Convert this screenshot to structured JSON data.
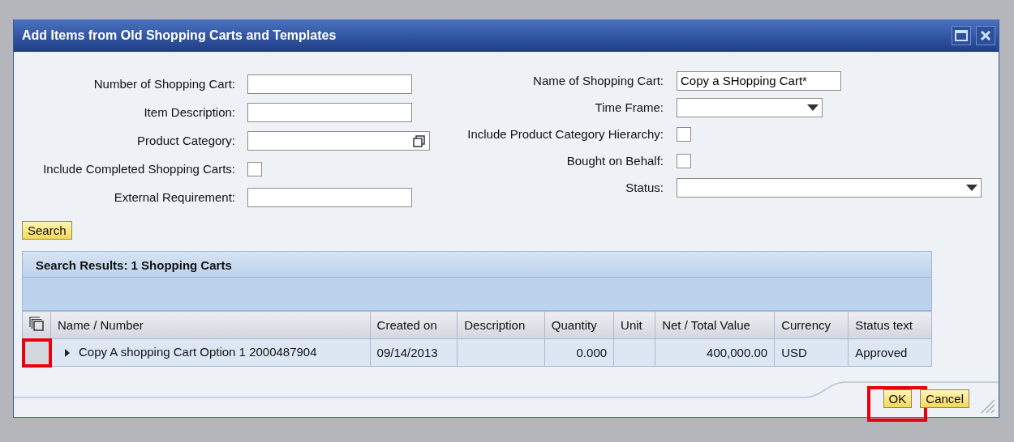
{
  "window": {
    "title": "Add Items from Old Shopping Carts and Templates"
  },
  "form_left": [
    {
      "label": "Number of Shopping Cart:",
      "kind": "text"
    },
    {
      "label": "Item Description:",
      "kind": "text"
    },
    {
      "label": "Product Category:",
      "kind": "value-help"
    },
    {
      "label": "Include Completed Shopping Carts:",
      "kind": "checkbox",
      "checked": false
    },
    {
      "label": "External Requirement:",
      "kind": "text"
    }
  ],
  "form_right": [
    {
      "label": "Name of Shopping Cart:",
      "kind": "text",
      "value": "Copy a SHopping Cart*"
    },
    {
      "label": "Time Frame:",
      "kind": "dropdown"
    },
    {
      "label": "Include Product Category Hierarchy:",
      "kind": "checkbox",
      "checked": false
    },
    {
      "label": "Bought on Behalf:",
      "kind": "checkbox",
      "checked": false
    },
    {
      "label": "Status:",
      "kind": "dropdown-wide"
    }
  ],
  "search_button": "Search",
  "table": {
    "title": "Search Results: 1 Shopping Carts",
    "columns": [
      {
        "label": "Name / Number",
        "kind": "text"
      },
      {
        "label": "Created on",
        "kind": "text"
      },
      {
        "label": "Description",
        "kind": "text"
      },
      {
        "label": "Quantity",
        "kind": "number"
      },
      {
        "label": "Unit",
        "kind": "text"
      },
      {
        "label": "Net / Total Value",
        "kind": "number"
      },
      {
        "label": "Currency",
        "kind": "text"
      },
      {
        "label": "Status text",
        "kind": "text"
      }
    ],
    "rows": [
      {
        "expanded": false,
        "highlighted": true,
        "cells": [
          "Copy A shopping Cart Option 1 2000487904",
          "09/14/2013",
          "",
          "0.000",
          "",
          "400,000.00",
          "USD",
          "Approved"
        ]
      }
    ]
  },
  "buttons": [
    {
      "label": "OK",
      "highlighted": true
    },
    {
      "label": "Cancel",
      "highlighted": false
    }
  ]
}
